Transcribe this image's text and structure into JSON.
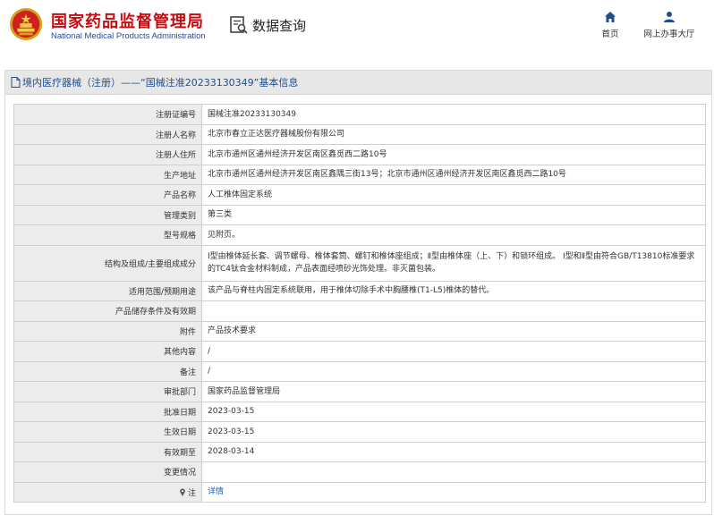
{
  "header": {
    "brand_cn": "国家药品监督管理局",
    "brand_en": "National Medical Products Administration",
    "data_query": "数据查询",
    "nav": [
      {
        "label": "首页",
        "icon": "home-icon"
      },
      {
        "label": "网上办事大厅",
        "icon": "user-icon"
      }
    ]
  },
  "panel": {
    "title": "境内医疗器械（注册）——“国械注准20233130349”基本信息"
  },
  "table": {
    "rows": [
      {
        "label": "注册证编号",
        "value": "国械注准20233130349"
      },
      {
        "label": "注册人名称",
        "value": "北京市春立正达医疗器械股份有限公司"
      },
      {
        "label": "注册人住所",
        "value": "北京市通州区通州经济开发区南区鑫觅西二路10号"
      },
      {
        "label": "生产地址",
        "value": "北京市通州区通州经济开发区南区鑫隅三街13号；北京市通州区通州经济开发区南区鑫觅西二路10号"
      },
      {
        "label": "产品名称",
        "value": "人工椎体固定系统"
      },
      {
        "label": "管理类别",
        "value": "第三类"
      },
      {
        "label": "型号规格",
        "value": "见附页。"
      },
      {
        "label": "结构及组成/主要组成成分",
        "value": "Ⅰ型由椎体延长套、调节螺母、椎体套筒、螺钉和椎体座组成；Ⅱ型由椎体座（上、下）和锁环组成。 Ⅰ型和Ⅱ型由符合GB/T13810标准要求的TC4钛合金材料制成，产品表面经喷砂光饰处理。非灭菌包装。"
      },
      {
        "label": "适用范围/预期用途",
        "value": "该产品与脊柱内固定系统联用，用于椎体切除手术中胸腰椎(T1-L5)椎体的替代。"
      },
      {
        "label": "产品储存条件及有效期",
        "value": ""
      },
      {
        "label": "附件",
        "value": "产品技术要求"
      },
      {
        "label": "其他内容",
        "value": "/"
      },
      {
        "label": "备注",
        "value": "/"
      },
      {
        "label": "审批部门",
        "value": "国家药品监督管理局"
      },
      {
        "label": "批准日期",
        "value": "2023-03-15"
      },
      {
        "label": "生效日期",
        "value": "2023-03-15"
      },
      {
        "label": "有效期至",
        "value": "2028-03-14"
      },
      {
        "label": "变更情况",
        "value": ""
      },
      {
        "label": "注",
        "value": "详情"
      }
    ]
  },
  "colors": {
    "brand_red": "#c40d12",
    "brand_blue": "#2a4b8d",
    "title_blue": "#214f8f",
    "link_blue": "#1f5fae",
    "label_bg": "#ececec"
  }
}
